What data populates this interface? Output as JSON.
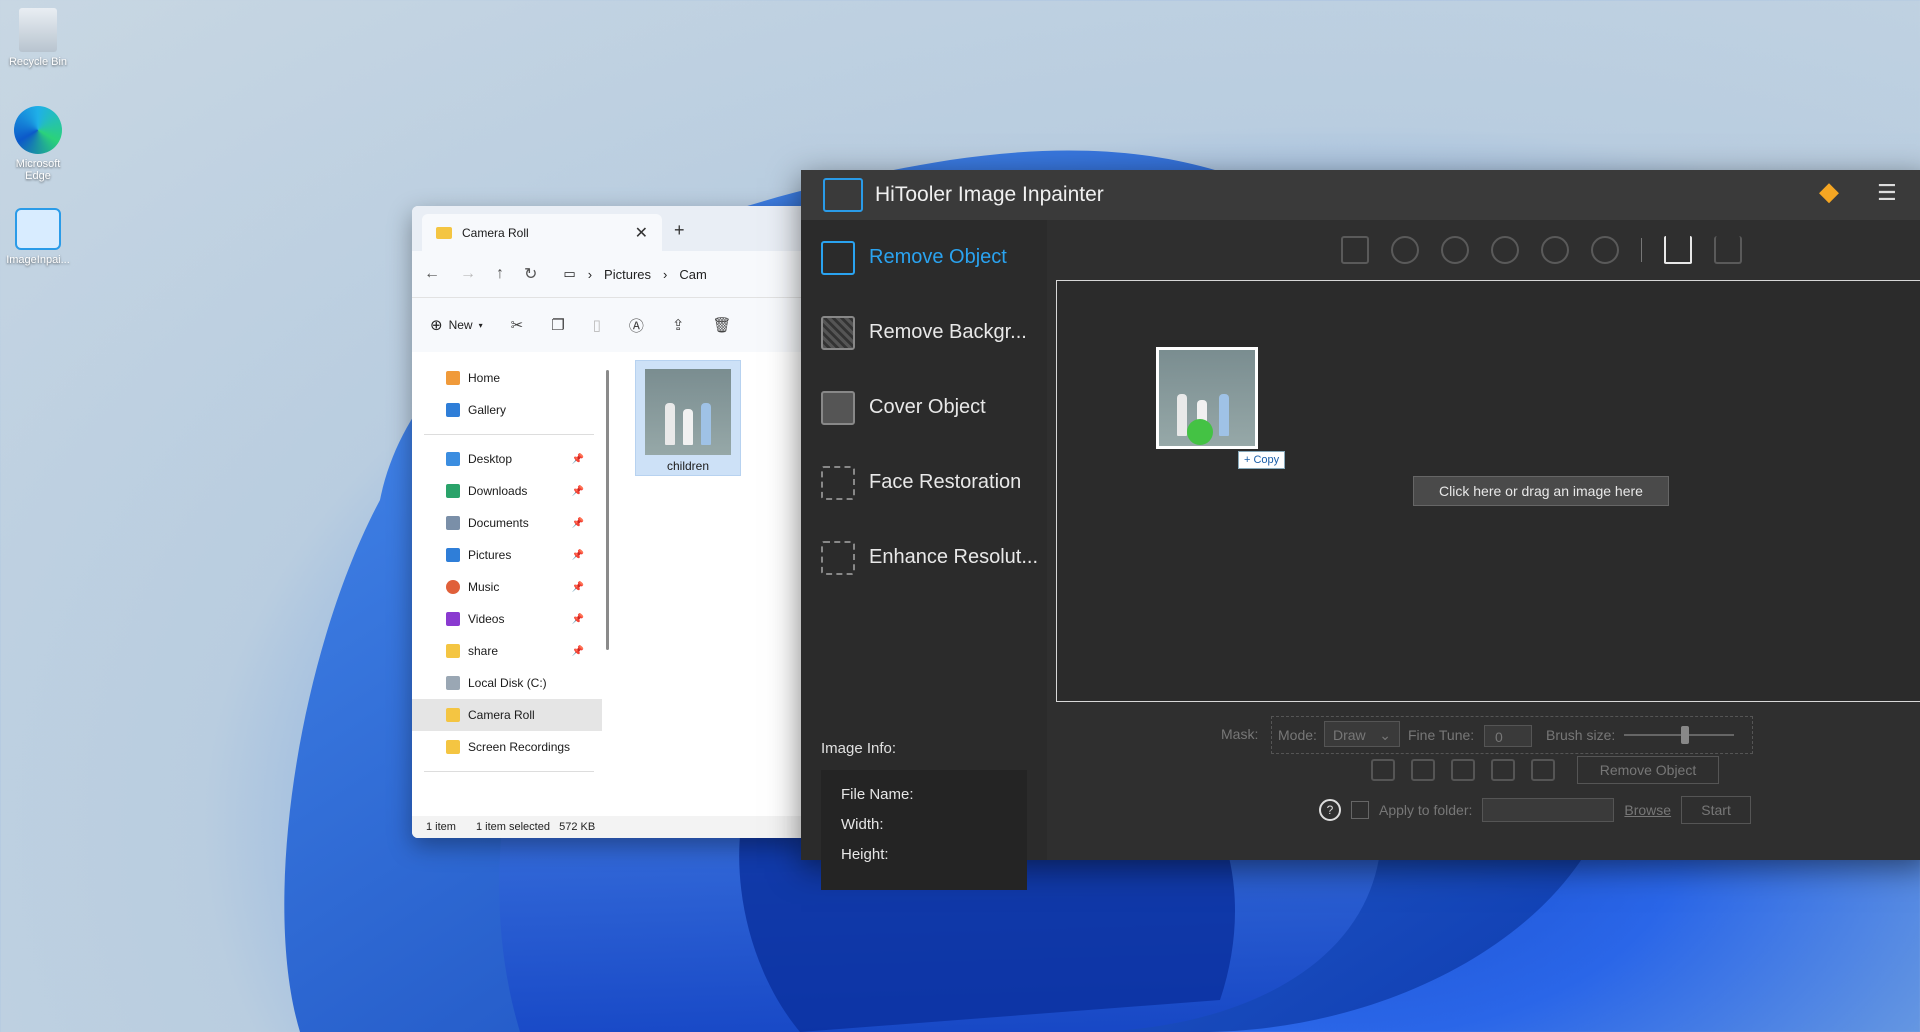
{
  "desktop": {
    "icons": [
      {
        "label": "Recycle Bin"
      },
      {
        "label": "Microsoft Edge"
      },
      {
        "label": "ImageInpai..."
      }
    ]
  },
  "explorer": {
    "tab_title": "Camera Roll",
    "new_tab": "+",
    "close": "✕",
    "breadcrumb": [
      "Pictures",
      "Cam"
    ],
    "new_label": "New",
    "sidebar": {
      "top": [
        {
          "label": "Home"
        },
        {
          "label": "Gallery"
        }
      ],
      "pinned": [
        {
          "label": "Desktop"
        },
        {
          "label": "Downloads"
        },
        {
          "label": "Documents"
        },
        {
          "label": "Pictures"
        },
        {
          "label": "Music"
        },
        {
          "label": "Videos"
        },
        {
          "label": "share"
        }
      ],
      "drives": [
        {
          "label": "Local Disk (C:)"
        },
        {
          "label": "Camera Roll"
        },
        {
          "label": "Screen Recordings"
        }
      ]
    },
    "file": {
      "name": "children"
    },
    "status": {
      "count": "1 item",
      "selected": "1 item selected",
      "size": "572 KB"
    }
  },
  "app": {
    "title": "HiTooler Image Inpainter",
    "nav": [
      {
        "label": "Remove Object"
      },
      {
        "label": "Remove Backgr..."
      },
      {
        "label": "Cover Object"
      },
      {
        "label": "Face Restoration"
      },
      {
        "label": "Enhance Resolut..."
      }
    ],
    "image_info": {
      "heading": "Image Info:",
      "file_name": "File Name:",
      "width": "Width:",
      "height": "Height:"
    },
    "canvas": {
      "drop_label": "Click here or drag an image here",
      "copy_tag": "+ Copy"
    },
    "mask": {
      "label": "Mask:",
      "mode_label": "Mode:",
      "mode_value": "Draw",
      "fine_tune_label": "Fine Tune:",
      "fine_tune_value": "0",
      "brush_label": "Brush size:",
      "brush_level": 0.55
    },
    "remove_button": "Remove Object",
    "apply_label": "Apply to folder:",
    "browse": "Browse",
    "start": "Start",
    "help": "?"
  }
}
